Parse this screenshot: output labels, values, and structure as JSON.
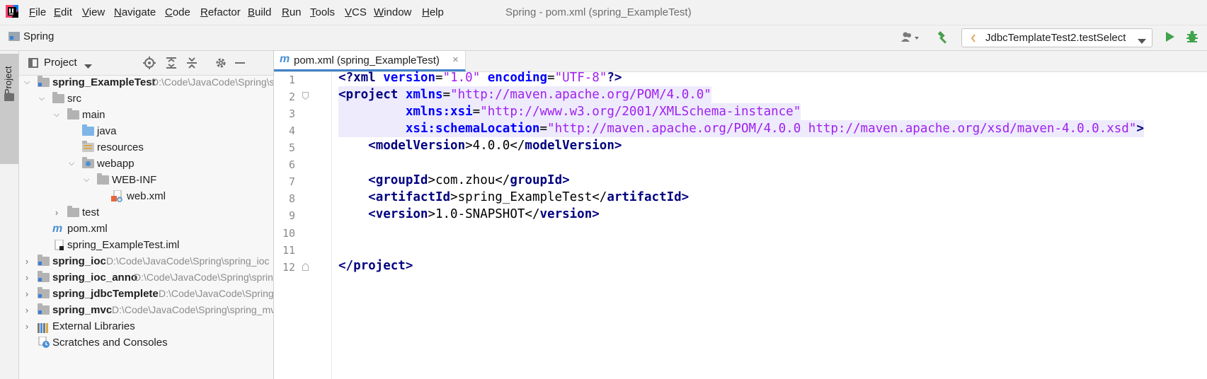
{
  "menu": [
    "File",
    "Edit",
    "View",
    "Navigate",
    "Code",
    "Refactor",
    "Build",
    "Run",
    "Tools",
    "VCS",
    "Window",
    "Help"
  ],
  "window_title": "Spring - pom.xml (spring_ExampleTest)",
  "nav": {
    "project_name": "Spring",
    "run_config": "JdbcTemplateTest2.testSelect"
  },
  "side_stripe": {
    "label": "Project"
  },
  "project_panel": {
    "title": "Project",
    "tree": [
      {
        "label": "spring_ExampleTest",
        "path": "D:\\Code\\JavaCode\\Spring\\spring_ExampleTest",
        "expanded": true,
        "bold": true
      },
      {
        "label": "src",
        "expanded": true
      },
      {
        "label": "main",
        "expanded": true
      },
      {
        "label": "java"
      },
      {
        "label": "resources"
      },
      {
        "label": "webapp",
        "expanded": true
      },
      {
        "label": "WEB-INF",
        "expanded": true
      },
      {
        "label": "web.xml"
      },
      {
        "label": "test",
        "expanded": false
      },
      {
        "label": "pom.xml"
      },
      {
        "label": "spring_ExampleTest.iml"
      },
      {
        "label": "spring_ioc",
        "path": "D:\\Code\\JavaCode\\Spring\\spring_ioc",
        "expanded": false
      },
      {
        "label": "spring_ioc_anno",
        "path": "D:\\Code\\JavaCode\\Spring\\spring_ioc_anno",
        "expanded": false
      },
      {
        "label": "spring_jdbcTemplete",
        "path": "D:\\Code\\JavaCode\\Spring\\spring_jdbcTemplete",
        "expanded": false
      },
      {
        "label": "spring_mvc",
        "path": "D:\\Code\\JavaCode\\Spring\\spring_mvc",
        "expanded": false
      },
      {
        "label": "External Libraries",
        "expanded": false
      },
      {
        "label": "Scratches and Consoles"
      }
    ]
  },
  "editor": {
    "tab_label": "pom.xml (spring_ExampleTest)",
    "line_numbers": [
      "1",
      "2",
      "3",
      "4",
      "5",
      "6",
      "7",
      "8",
      "9",
      "10",
      "11",
      "12"
    ],
    "code": {
      "l1_a": "<?",
      "l1_b": "xml ",
      "l1_c": "version",
      "l1_d": "=",
      "l1_e": "\"1.0\"",
      "l1_f": " encoding",
      "l1_g": "=",
      "l1_h": "\"UTF-8\"",
      "l1_i": "?>",
      "l2_a": "<",
      "l2_b": "project ",
      "l2_c": "xmlns",
      "l2_d": "=",
      "l2_e": "\"http://maven.apache.org/POM/4.0.0\"",
      "l3_a": "         xmlns:xsi",
      "l3_b": "=",
      "l3_c": "\"http://www.w3.org/2001/XMLSchema-instance\"",
      "l4_a": "         xsi:schemaLocation",
      "l4_b": "=",
      "l4_c": "\"http://maven.apache.org/POM/4.0.0 http://maven.apache.org/xsd/maven-4.0.0.xsd\"",
      "l4_d": ">",
      "l5_a": "    <",
      "l5_b": "modelVersion",
      "l5_c": ">4.0.0</",
      "l5_d": "modelVersion",
      "l5_e": ">",
      "l7_a": "    <",
      "l7_b": "groupId",
      "l7_c": ">com.zhou</",
      "l7_d": "groupId",
      "l7_e": ">",
      "l8_a": "    <",
      "l8_b": "artifactId",
      "l8_c": ">spring_ExampleTest</",
      "l8_d": "artifactId",
      "l8_e": ">",
      "l9_a": "    <",
      "l9_b": "version",
      "l9_c": ">1.0-SNAPSHOT</",
      "l9_d": "version",
      "l9_e": ">",
      "l12_a": "</",
      "l12_b": "project",
      "l12_c": ">"
    }
  },
  "colors": {
    "tag": "#000080",
    "attribute": "#0000ff",
    "value": "#a020f0",
    "caret_line": "#fffae3",
    "tab_underline": "#4083c9",
    "run_green": "#3ea34a"
  }
}
